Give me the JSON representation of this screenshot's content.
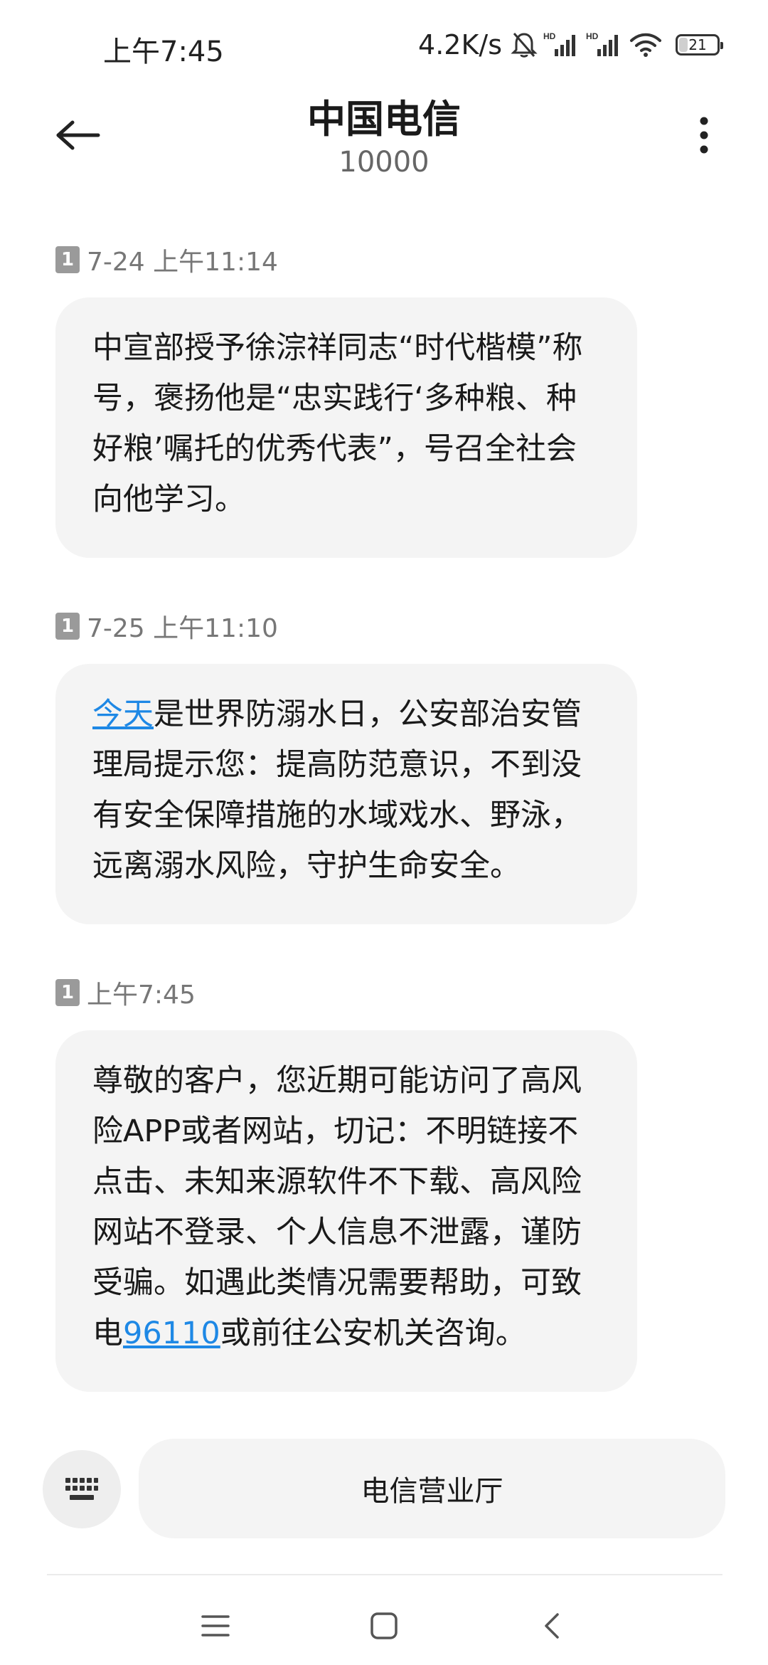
{
  "status_bar": {
    "time": "上午7:45",
    "net_speed": "4.2K/s",
    "signal_labels": [
      "HD",
      "HD"
    ],
    "battery_level": "21",
    "icons": [
      "mute-bell-icon",
      "hd-signal-icon",
      "hd-signal-icon",
      "wifi-icon",
      "battery-icon"
    ]
  },
  "header": {
    "contact_name": "中国电信",
    "contact_number": "10000",
    "back_icon": "arrow-left-icon",
    "more_icon": "more-vertical-icon"
  },
  "messages": [
    {
      "sim": "1",
      "timestamp": "7-24 上午11:14",
      "body": "中宣部授予徐淙祥同志“时代楷模”称号，褒扬他是“忠实践行‘多种粮、种好粮’嘱托的优秀代表”，号召全社会向他学习。"
    },
    {
      "sim": "1",
      "timestamp": "7-25 上午11:10",
      "link": "今天",
      "body_after_link": "是世界防溺水日，公安部治安管理局提示您：提高防范意识，不到没有安全保障措施的水域戏水、野泳，远离溺水风险，守护生命安全。"
    },
    {
      "sim": "1",
      "timestamp": "上午7:45",
      "body_before_link": "尊敬的客户，您近期可能访问了高风险APP或者网站，切记：不明链接不点击、未知来源软件不下载、高风险网站不登录、个人信息不泄露，谨防受骗。如遇此类情况需要帮助，可致电",
      "link": "96110",
      "body_after_link": "或前往公安机关咨询。"
    }
  ],
  "input_row": {
    "keyboard_icon": "keyboard-icon",
    "quick_reply_label": "电信营业厅"
  },
  "nav_bar": {
    "icons": [
      "menu-icon",
      "home-square-icon",
      "back-chevron-icon"
    ]
  },
  "colors": {
    "link": "#1e88e5",
    "bubble_bg": "#f4f4f4",
    "meta_text": "#777777"
  }
}
